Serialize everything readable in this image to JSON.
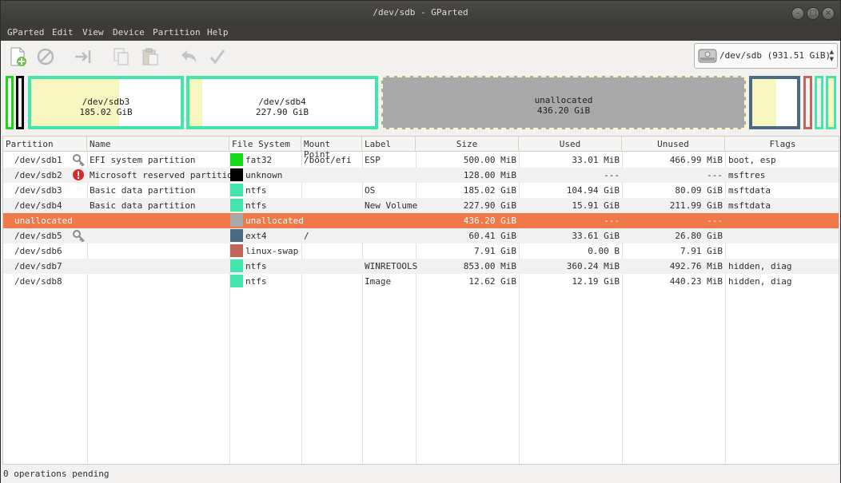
{
  "window": {
    "title": "/dev/sdb - GParted"
  },
  "menu": [
    "GParted",
    "Edit",
    "View",
    "Device",
    "Partition",
    "Help"
  ],
  "device": {
    "label": "/dev/sdb  (931.51 GiB)"
  },
  "map": {
    "sdb3": {
      "name": "/dev/sdb3",
      "size": "185.02 GiB"
    },
    "sdb4": {
      "name": "/dev/sdb4",
      "size": "227.90 GiB"
    },
    "unalloc": {
      "name": "unallocated",
      "size": "436.20 GiB"
    }
  },
  "table": {
    "headers": [
      "Partition",
      "Name",
      "File System",
      "Mount Point",
      "Label",
      "Size",
      "Used",
      "Unused",
      "Flags"
    ],
    "rows": [
      {
        "partition": "/dev/sdb1",
        "name": "EFI system partition",
        "fs": "fat32",
        "mount": "/boot/efi",
        "label": "ESP",
        "size": "500.00 MiB",
        "used": "33.01 MiB",
        "unused": "466.99 MiB",
        "flags": "boot, esp"
      },
      {
        "partition": "/dev/sdb2",
        "name": "Microsoft reserved partition",
        "fs": "unknown",
        "mount": "",
        "label": "",
        "size": "128.00 MiB",
        "used": "---",
        "unused": "---",
        "flags": "msftres"
      },
      {
        "partition": "/dev/sdb3",
        "name": "Basic data partition",
        "fs": "ntfs",
        "mount": "",
        "label": "OS",
        "size": "185.02 GiB",
        "used": "104.94 GiB",
        "unused": "80.09 GiB",
        "flags": "msftdata"
      },
      {
        "partition": "/dev/sdb4",
        "name": "Basic data partition",
        "fs": "ntfs",
        "mount": "",
        "label": "New Volume",
        "size": "227.90 GiB",
        "used": "15.91 GiB",
        "unused": "211.99 GiB",
        "flags": "msftdata"
      },
      {
        "partition": "unallocated",
        "name": "",
        "fs": "unallocated",
        "mount": "",
        "label": "",
        "size": "436.20 GiB",
        "used": "---",
        "unused": "---",
        "flags": ""
      },
      {
        "partition": "/dev/sdb5",
        "name": "",
        "fs": "ext4",
        "mount": "/",
        "label": "",
        "size": "60.41 GiB",
        "used": "33.61 GiB",
        "unused": "26.80 GiB",
        "flags": ""
      },
      {
        "partition": "/dev/sdb6",
        "name": "",
        "fs": "linux-swap",
        "mount": "",
        "label": "",
        "size": "7.91 GiB",
        "used": "0.00 B",
        "unused": "7.91 GiB",
        "flags": ""
      },
      {
        "partition": "/dev/sdb7",
        "name": "",
        "fs": "ntfs",
        "mount": "",
        "label": "WINRETOOLS",
        "size": "853.00 MiB",
        "used": "360.24 MiB",
        "unused": "492.76 MiB",
        "flags": "hidden, diag"
      },
      {
        "partition": "/dev/sdb8",
        "name": "",
        "fs": "ntfs",
        "mount": "",
        "label": "Image",
        "size": "12.62 GiB",
        "used": "12.19 GiB",
        "unused": "440.23 MiB",
        "flags": "hidden, diag"
      }
    ]
  },
  "fs_colors": {
    "fat32": "#18d918",
    "unknown": "#000000",
    "ntfs": "#42e5ac",
    "unallocated": "#a9a9a9",
    "ext4": "#4b6983",
    "linux-swap": "#c1665a"
  },
  "selection_color": "#f0794a",
  "status": {
    "text": "0 operations pending"
  }
}
